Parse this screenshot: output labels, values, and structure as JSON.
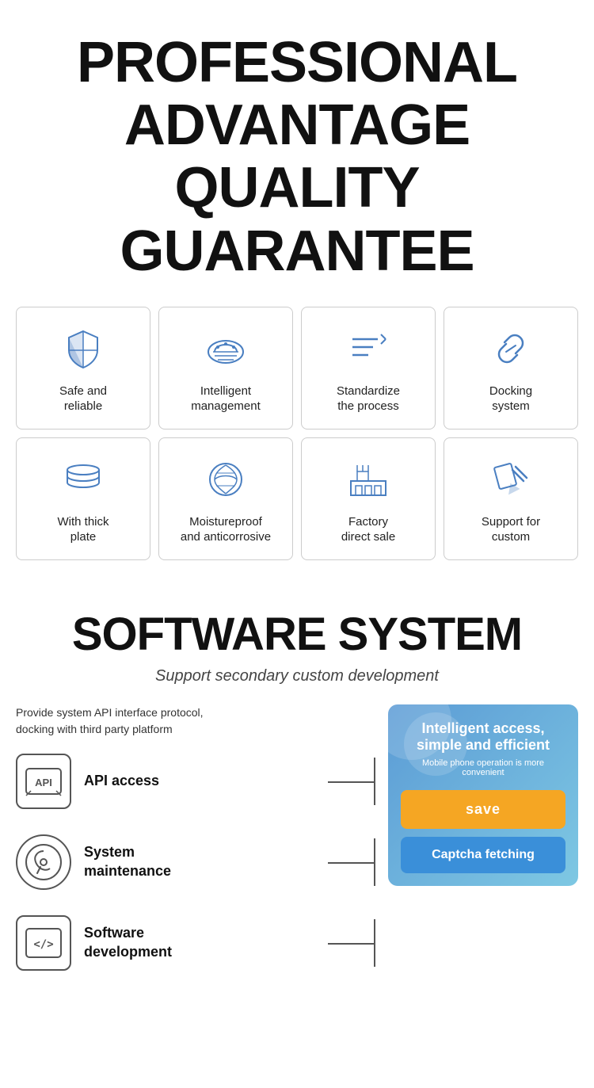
{
  "header": {
    "line1": "PROFESSIONAL",
    "line2": "ADVANTAGE",
    "line3": "QUALITY GUARANTEE"
  },
  "grid": {
    "row1": [
      {
        "id": "safe-reliable",
        "label": "Safe and\nreliable",
        "icon": "shield"
      },
      {
        "id": "intelligent-mgmt",
        "label": "Intelligent\nmanagement",
        "icon": "cloud-settings"
      },
      {
        "id": "standardize-process",
        "label": "Standardize\nthe process",
        "icon": "process"
      },
      {
        "id": "docking-system",
        "label": "Docking\nsystem",
        "icon": "link"
      }
    ],
    "row2": [
      {
        "id": "thick-plate",
        "label": "With thick\nplate",
        "icon": "layers"
      },
      {
        "id": "moistureproof",
        "label": "Moistureproof\nand anticorrosive",
        "icon": "leaf"
      },
      {
        "id": "factory-direct",
        "label": "Factory\ndirect sale",
        "icon": "factory"
      },
      {
        "id": "support-custom",
        "label": "Support for\ncustom",
        "icon": "edit-tools"
      }
    ]
  },
  "software": {
    "title": "SOFTWARE SYSTEM",
    "subtitle": "Support secondary custom development",
    "description": "Provide system API interface protocol,\ndocking with third party platform",
    "features": [
      {
        "id": "api-access",
        "label": "API access",
        "icon": "api"
      },
      {
        "id": "system-maintenance",
        "label": "System\nmaintenance",
        "icon": "maintenance"
      },
      {
        "id": "software-dev",
        "label": "Software\ndevelopment",
        "icon": "code"
      }
    ],
    "panel": {
      "main_text": "Intelligent access,\nsimple and efficient",
      "sub_text": "Mobile phone operation is more\nconvenient",
      "save_label": "save",
      "captcha_label": "Captcha fetching"
    }
  }
}
